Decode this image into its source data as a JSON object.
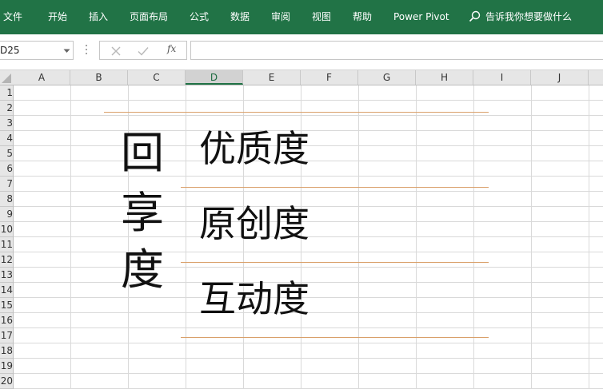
{
  "ribbon": {
    "tabs": [
      "文件",
      "开始",
      "插入",
      "页面布局",
      "公式",
      "数据",
      "审阅",
      "视图",
      "帮助",
      "Power Pivot"
    ],
    "tell_me": "告诉我你想要做什么",
    "color": "#217346"
  },
  "formula_bar": {
    "name_box": "D25",
    "fx": "fx",
    "formula": ""
  },
  "columns": [
    "A",
    "B",
    "C",
    "D",
    "E",
    "F",
    "G",
    "H",
    "I",
    "J"
  ],
  "active_column": "D",
  "rows": [
    "1",
    "2",
    "3",
    "4",
    "5",
    "6",
    "7",
    "8",
    "9",
    "10",
    "11",
    "12",
    "13",
    "14",
    "15",
    "16",
    "17",
    "18",
    "19",
    "20"
  ],
  "sheet": {
    "title_chars": [
      "回",
      "享",
      "度"
    ],
    "items": [
      "优质度",
      "原创度",
      "互动度"
    ],
    "line_color": "#d9a06a"
  }
}
